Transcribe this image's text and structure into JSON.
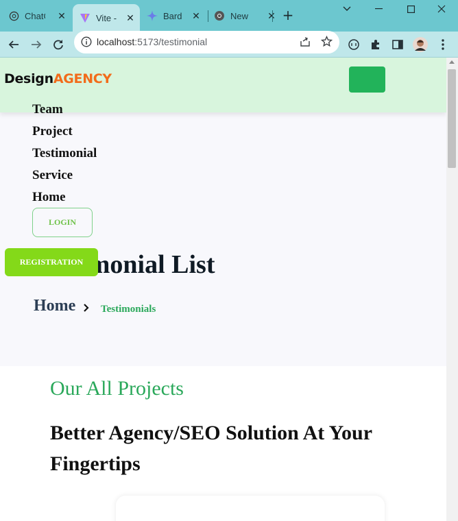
{
  "browser": {
    "tabs": [
      {
        "title": "ChatG",
        "icon": "openai-icon"
      },
      {
        "title": "Vite -",
        "icon": "vite-icon",
        "active": true
      },
      {
        "title": "Bard",
        "icon": "bard-icon"
      },
      {
        "title": "New",
        "icon": "chrome-icon"
      }
    ],
    "new_tab_label": "+",
    "url_host": "localhost",
    "url_path": ":5173/testimonial"
  },
  "site": {
    "logo_main": "Design",
    "logo_accent": "AGENCY",
    "accent_color": "#f26c1b",
    "brand_green": "#22b35a",
    "nav": [
      "Team",
      "Project",
      "Testimonial",
      "Service",
      "Home"
    ],
    "login_label": "LOGIN",
    "register_label": "REGISTRATION"
  },
  "hero": {
    "title": "Testimonial List",
    "breadcrumb_home": "Home",
    "breadcrumb_current": "Testimonials"
  },
  "section": {
    "kicker": "Our All Projects",
    "title": "Better Agency/SEO Solution At Your Fingertips"
  }
}
